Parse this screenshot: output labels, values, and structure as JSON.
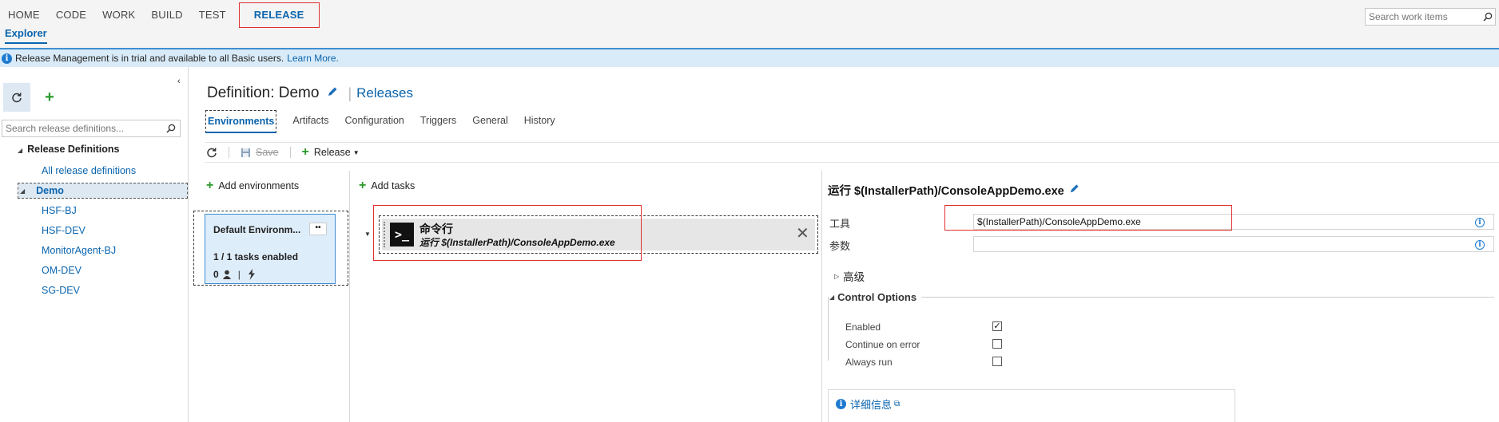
{
  "topnav": {
    "items": [
      "HOME",
      "CODE",
      "WORK",
      "BUILD",
      "TEST"
    ],
    "active": "RELEASE",
    "subnav": "Explorer",
    "search_placeholder": "Search work items"
  },
  "banner": {
    "text": "Release Management is in trial and available to all Basic users.",
    "link": "Learn More."
  },
  "sidebar": {
    "search_placeholder": "Search release definitions...",
    "root_label": "Release Definitions",
    "all_label": "All release definitions",
    "selected": "Demo",
    "items": [
      "HSF-BJ",
      "HSF-DEV",
      "MonitorAgent-BJ",
      "OM-DEV",
      "SG-DEV"
    ]
  },
  "header": {
    "title": "Definition: Demo",
    "releases_link": "Releases",
    "tabs": [
      "Environments",
      "Artifacts",
      "Configuration",
      "Triggers",
      "General",
      "History"
    ],
    "active_tab": "Environments"
  },
  "toolbar": {
    "save_label": "Save",
    "release_label": "Release"
  },
  "environments": {
    "add_label": "Add environments",
    "card": {
      "title": "Default Environm...",
      "dots": "••",
      "tasks_enabled": "1 / 1 tasks enabled",
      "approvers": "0"
    }
  },
  "tasks": {
    "add_label": "Add tasks",
    "items": [
      {
        "name": "命令行",
        "subtitle": "运行 $(InstallerPath)/ConsoleAppDemo.exe",
        "icon": "terminal-icon"
      }
    ]
  },
  "properties": {
    "title": "运行 $(InstallerPath)/ConsoleAppDemo.exe",
    "tool_label": "工具",
    "tool_value": "$(InstallerPath)/ConsoleAppDemo.exe",
    "args_label": "参数",
    "args_value": "",
    "advanced_label": "高级",
    "control_options_label": "Control Options",
    "options": [
      {
        "label": "Enabled",
        "checked": true
      },
      {
        "label": "Continue on error",
        "checked": false
      },
      {
        "label": "Always run",
        "checked": false
      }
    ],
    "details_link": "详细信息"
  },
  "colors": {
    "accent": "#0a64ad",
    "banner_bg": "#d9ebf8",
    "highlight": "#e03030",
    "green": "#2a9a2a"
  }
}
